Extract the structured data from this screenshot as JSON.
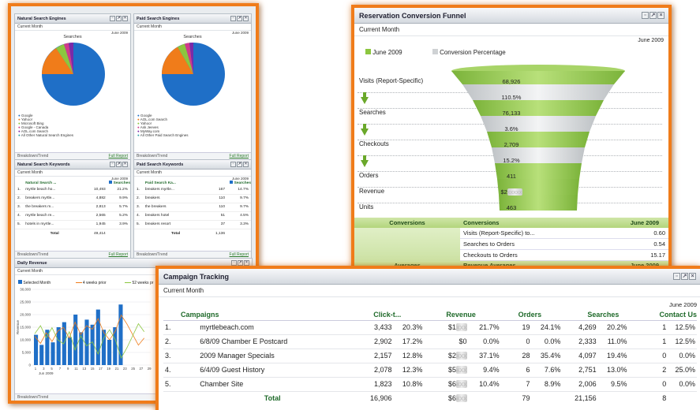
{
  "natural_engines": {
    "title": "Natural Search Engines",
    "period": "Current Month",
    "date": "June 2009",
    "chart_title": "Searches",
    "legend": [
      "Google",
      "Yahoo!",
      "Microsoft Bing",
      "Google - Canada",
      "AOL.com Search",
      "All Other Natural Search Engines"
    ],
    "footer_left": "Breakdown/Trend",
    "footer_link": "Full Report"
  },
  "paid_engines": {
    "title": "Paid Search Engines",
    "period": "Current Month",
    "date": "June 2009",
    "chart_title": "Searches",
    "legend": [
      "Google",
      "AOL.com Search",
      "Yahoo!",
      "Ask Jeeves",
      "MyWay.com",
      "All Other Paid Search Engines"
    ],
    "footer_left": "Breakdown/Trend",
    "footer_link": "Full Report"
  },
  "natural_keywords": {
    "title": "Natural Search Keywords",
    "period": "Current Month",
    "date": "June 2009",
    "col1": "Natural Search ...",
    "col2": "Searches",
    "rows": [
      {
        "n": "1.",
        "k": "myrtle beach ho...",
        "v": "10,493",
        "p": "21.2%"
      },
      {
        "n": "2.",
        "k": "breakers myrtle...",
        "v": "4,882",
        "p": "9.9%"
      },
      {
        "n": "3.",
        "k": "the breakers m...",
        "v": "2,813",
        "p": "5.7%"
      },
      {
        "n": "4.",
        "k": "myrtle beach re...",
        "v": "2,565",
        "p": "5.2%"
      },
      {
        "n": "5.",
        "k": "hotels in myrtle...",
        "v": "1,945",
        "p": "3.9%"
      }
    ],
    "total_label": "Total",
    "total": "49,414",
    "footer_left": "Breakdown/Trend",
    "footer_link": "Full Report"
  },
  "paid_keywords": {
    "title": "Paid Search Keywords",
    "period": "Current Month",
    "date": "June 2009",
    "col1": "Paid Search Ka...",
    "col2": "Searches",
    "rows": [
      {
        "n": "1.",
        "k": "breakers myrtle...",
        "v": "167",
        "p": "14.7%"
      },
      {
        "n": "2.",
        "k": "breakers",
        "v": "110",
        "p": "9.7%"
      },
      {
        "n": "3.",
        "k": "the breakers",
        "v": "110",
        "p": "9.7%"
      },
      {
        "n": "4.",
        "k": "breakers hotel",
        "v": "51",
        "p": "4.5%"
      },
      {
        "n": "5.",
        "k": "breakers resort",
        "v": "37",
        "p": "3.3%"
      }
    ],
    "total_label": "Total",
    "total": "1,136",
    "footer_left": "Breakdown/Trend",
    "footer_link": "Full Report"
  },
  "daily_revenue": {
    "title": "Daily Revenue",
    "period": "Current Month",
    "legend": [
      "Selected Month",
      "4 weeks prior",
      "52 weeks pr"
    ],
    "y_ticks": [
      "30,000",
      "25,000",
      "20,000",
      "15,000",
      "10,000",
      "5,000",
      "0"
    ],
    "x_ticks": [
      "1",
      "3",
      "5",
      "7",
      "9",
      "11",
      "13",
      "15",
      "17",
      "19",
      "21",
      "23",
      "25",
      "27",
      "29"
    ],
    "x_label": "Jun 2009",
    "y_label": "Revenue",
    "footer_left": "Breakdown/Trend"
  },
  "funnel": {
    "title": "Reservation Conversion Funnel",
    "period": "Current Month",
    "date": "June 2009",
    "legend_month": "June 2009",
    "legend_pct": "Conversion Percentage",
    "stages": [
      {
        "label": "Visits (Report-Specific)",
        "value": "68,926"
      },
      {
        "label": "",
        "value": "110.5%"
      },
      {
        "label": "Searches",
        "value": "76,133"
      },
      {
        "label": "",
        "value": "3.6%"
      },
      {
        "label": "Checkouts",
        "value": "2,709"
      },
      {
        "label": "",
        "value": "15.2%"
      },
      {
        "label": "Orders",
        "value": "411"
      },
      {
        "label": "Revenue",
        "value": "$2"
      },
      {
        "label": "Units",
        "value": "463"
      }
    ],
    "conv_header_left": "Conversions",
    "conv_header_mid": "Conversions",
    "conv_header_right": "June 2009",
    "conv_rows": [
      {
        "k": "Visits (Report-Specific) to...",
        "v": "0.60"
      },
      {
        "k": "Searches to Orders",
        "v": "0.54"
      },
      {
        "k": "Checkouts to Orders",
        "v": "15.17"
      }
    ],
    "avg_left": "Averages",
    "avg_mid": "Revenue Averages",
    "avg_right": "June 2009"
  },
  "campaign": {
    "title": "Campaign Tracking",
    "period": "Current Month",
    "date": "June 2009",
    "columns": [
      "Campaigns",
      "Click-t...",
      "Revenue",
      "Orders",
      "Searches",
      "Contact Us"
    ],
    "rows": [
      {
        "n": "1.",
        "name": "myrtlebeach.com",
        "c": "3,433",
        "cp": "20.3%",
        "r": "$1",
        "rp": "21.7%",
        "o": "19",
        "op": "24.1%",
        "s": "4,269",
        "sp": "20.2%",
        "u": "1",
        "up": "12.5%"
      },
      {
        "n": "2.",
        "name": "6/8/09 Chamber E Postcard",
        "c": "2,902",
        "cp": "17.2%",
        "r": "$0",
        "rp": "0.0%",
        "o": "0",
        "op": "0.0%",
        "s": "2,333",
        "sp": "11.0%",
        "u": "1",
        "up": "12.5%"
      },
      {
        "n": "3.",
        "name": "2009 Manager Specials",
        "c": "2,157",
        "cp": "12.8%",
        "r": "$2",
        "rp": "37.1%",
        "o": "28",
        "op": "35.4%",
        "s": "4,097",
        "sp": "19.4%",
        "u": "0",
        "up": "0.0%"
      },
      {
        "n": "4.",
        "name": "6/4/09 Guest History",
        "c": "2,078",
        "cp": "12.3%",
        "r": "$5",
        "rp": "9.4%",
        "o": "6",
        "op": "7.6%",
        "s": "2,751",
        "sp": "13.0%",
        "u": "2",
        "up": "25.0%"
      },
      {
        "n": "5.",
        "name": "Chamber Site",
        "c": "1,823",
        "cp": "10.8%",
        "r": "$6",
        "rp": "10.4%",
        "o": "7",
        "op": "8.9%",
        "s": "2,006",
        "sp": "9.5%",
        "u": "0",
        "up": "0.0%"
      }
    ],
    "total_label": "Total",
    "total_c": "16,906",
    "total_r": "$6",
    "total_o": "79",
    "total_s": "21,156",
    "total_u": "8"
  },
  "colors": {
    "frame": "#f07c1a",
    "accent_green": "#8cc63f",
    "header_green": "#1f6a2a",
    "bar_blue": "#1f6fc7"
  }
}
